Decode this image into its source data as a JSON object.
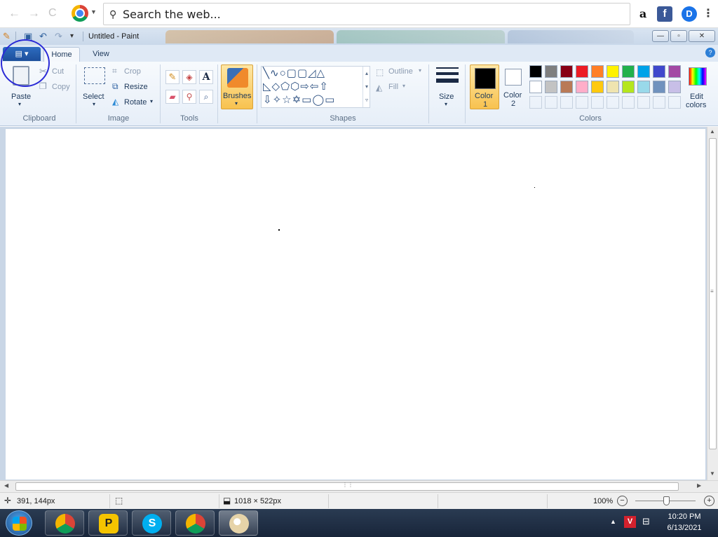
{
  "browser": {
    "back_icon": "←",
    "forward_icon": "→",
    "reload_icon": "C",
    "search_icon": "⚲",
    "search_placeholder": "Search the web...",
    "ext_amazon": "a",
    "ext_facebook": "f",
    "ext_d": "D",
    "menu_icon": "⋮"
  },
  "window": {
    "title": "Untitled - Paint",
    "minimize": "—",
    "maximize": "▫",
    "close": "✕"
  },
  "tabs": {
    "file_icon": "▤ ▾",
    "home": "Home",
    "view": "View",
    "help": "?"
  },
  "ribbon": {
    "clipboard": {
      "paste": "Paste",
      "cut": "Cut",
      "copy": "Copy",
      "group": "Clipboard"
    },
    "image": {
      "select": "Select",
      "crop": "Crop",
      "resize": "Resize",
      "rotate": "Rotate",
      "group": "Image"
    },
    "tools": {
      "group": "Tools",
      "text_tool": "A"
    },
    "brushes": {
      "label": "Brushes"
    },
    "shapes": {
      "outline": "Outline",
      "fill": "Fill",
      "group": "Shapes"
    },
    "size": {
      "label": "Size"
    },
    "colors": {
      "color1_label": "Color",
      "color1_num": "1",
      "color2_label": "Color",
      "color2_num": "2",
      "edit1": "Edit",
      "edit2": "colors",
      "group": "Colors",
      "row1": [
        "#000000",
        "#7f7f7f",
        "#880015",
        "#ed1c24",
        "#ff7f27",
        "#fff200",
        "#22b14c",
        "#00a2e8",
        "#3f48cc",
        "#a349a4"
      ],
      "row2": [
        "#ffffff",
        "#c3c3c3",
        "#b97a57",
        "#ffaec9",
        "#ffc90e",
        "#efe4b0",
        "#b5e61d",
        "#99d9ea",
        "#7092be",
        "#c8bfe7"
      ]
    }
  },
  "status": {
    "cursor_pos": "391, 144px",
    "canvas_size": "1018 × 522px",
    "zoom": "100%"
  },
  "taskbar": {
    "time": "10:20 PM",
    "date": "6/13/2021"
  }
}
